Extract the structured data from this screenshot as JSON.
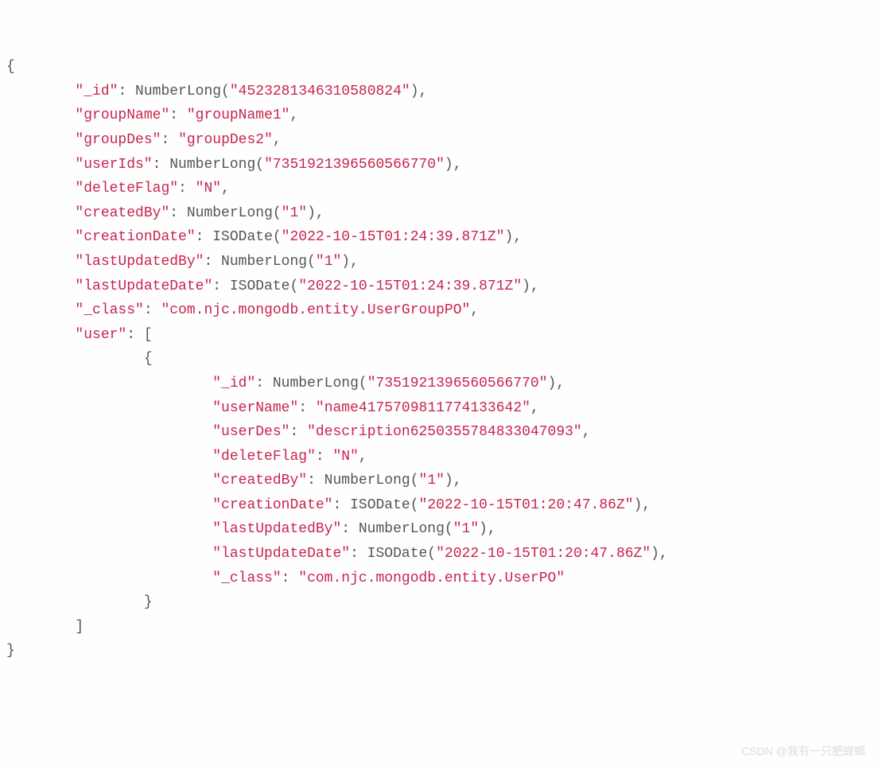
{
  "lines": [
    {
      "indent": 0,
      "text": "{",
      "type": "plain"
    },
    {
      "indent": 2,
      "key": "_id",
      "mid": ": NumberLong(",
      "val": "4523281346310580824",
      "after": "),"
    },
    {
      "indent": 2,
      "key": "groupName",
      "mid": ": ",
      "val": "groupName1",
      "after": ",",
      "strVal": true
    },
    {
      "indent": 2,
      "key": "groupDes",
      "mid": ": ",
      "val": "groupDes2",
      "after": ",",
      "strVal": true
    },
    {
      "indent": 2,
      "key": "userIds",
      "mid": ": NumberLong(",
      "val": "7351921396560566770",
      "after": "),"
    },
    {
      "indent": 2,
      "key": "deleteFlag",
      "mid": ": ",
      "val": "N",
      "after": ",",
      "strVal": true
    },
    {
      "indent": 2,
      "key": "createdBy",
      "mid": ": NumberLong(",
      "val": "1",
      "after": "),"
    },
    {
      "indent": 2,
      "key": "creationDate",
      "mid": ": ISODate(",
      "val": "2022-10-15T01:24:39.871Z",
      "after": "),"
    },
    {
      "indent": 2,
      "key": "lastUpdatedBy",
      "mid": ": NumberLong(",
      "val": "1",
      "after": "),"
    },
    {
      "indent": 2,
      "key": "lastUpdateDate",
      "mid": ": ISODate(",
      "val": "2022-10-15T01:24:39.871Z",
      "after": "),"
    },
    {
      "indent": 2,
      "key": "_class",
      "mid": ": ",
      "val": "com.njc.mongodb.entity.UserGroupPO",
      "after": ",",
      "strVal": true
    },
    {
      "indent": 2,
      "key": "user",
      "mid": ": [",
      "noval": true
    },
    {
      "indent": 4,
      "text": "{",
      "type": "plain"
    },
    {
      "indent": 6,
      "key": "_id",
      "mid": ": NumberLong(",
      "val": "7351921396560566770",
      "after": "),"
    },
    {
      "indent": 6,
      "key": "userName",
      "mid": ": ",
      "val": "name4175709811774133642",
      "after": ",",
      "strVal": true
    },
    {
      "indent": 6,
      "key": "userDes",
      "mid": ": ",
      "val": "description6250355784833047093",
      "after": ",",
      "strVal": true
    },
    {
      "indent": 6,
      "key": "deleteFlag",
      "mid": ": ",
      "val": "N",
      "after": ",",
      "strVal": true
    },
    {
      "indent": 6,
      "key": "createdBy",
      "mid": ": NumberLong(",
      "val": "1",
      "after": "),"
    },
    {
      "indent": 6,
      "key": "creationDate",
      "mid": ": ISODate(",
      "val": "2022-10-15T01:20:47.86Z",
      "after": "),"
    },
    {
      "indent": 6,
      "key": "lastUpdatedBy",
      "mid": ": NumberLong(",
      "val": "1",
      "after": "),"
    },
    {
      "indent": 6,
      "key": "lastUpdateDate",
      "mid": ": ISODate(",
      "val": "2022-10-15T01:20:47.86Z",
      "after": "),"
    },
    {
      "indent": 6,
      "key": "_class",
      "mid": ": ",
      "val": "com.njc.mongodb.entity.UserPO",
      "after": "",
      "strVal": true
    },
    {
      "indent": 4,
      "text": "}",
      "type": "plain"
    },
    {
      "indent": 2,
      "text": "]",
      "type": "plain"
    },
    {
      "indent": 0,
      "text": "}",
      "type": "plain"
    }
  ],
  "watermark": "CSDN @我有一只肥螳螂"
}
